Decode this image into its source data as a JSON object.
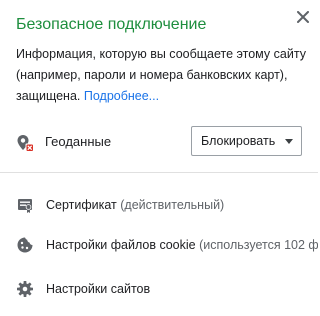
{
  "header": {
    "title": "Безопасное подключение",
    "close_icon": "close-icon"
  },
  "description": {
    "text": "Информация, которую вы сообщаете этому сайту (например, пароли и номера банковских карт), защищена.",
    "more_link": "Подробнее..."
  },
  "permissions": [
    {
      "icon": "location-blocked-icon",
      "label": "Геоданные",
      "value": "Блокировать"
    }
  ],
  "items": [
    {
      "icon": "certificate-icon",
      "label": "Сертификат",
      "sub": "(действительный)"
    },
    {
      "icon": "cookie-icon",
      "label": "Настройки файлов cookie",
      "sub": "(используется 102 фа"
    },
    {
      "icon": "settings-gear-icon",
      "label": "Настройки сайтов",
      "sub": ""
    }
  ],
  "colors": {
    "title": "#1e8e3e",
    "link": "#1a73e8",
    "icon": "#5f6368",
    "blocked_badge": "#d93025"
  }
}
